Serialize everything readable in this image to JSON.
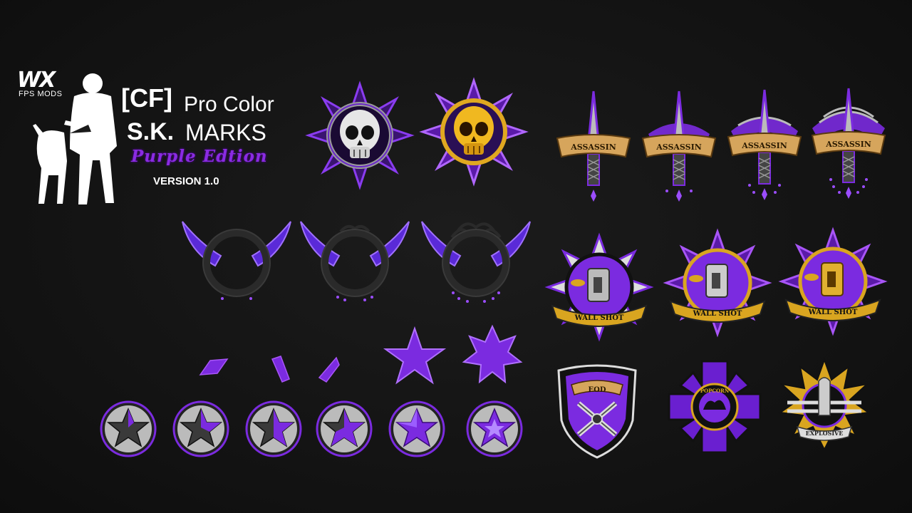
{
  "branding": {
    "logo_text": "WX",
    "logo_subtext": "FPS MODS"
  },
  "title": {
    "tag": "[CF]",
    "line1_rest": "Pro Color",
    "line2_bold": "S.K.",
    "line2_rest": "MARKS",
    "edition": "Purple Edtion",
    "version": "VERSION 1.0"
  },
  "badges": {
    "assassin_label": "ASSASSIN",
    "wallshot_label": "WALL SHOT",
    "eod_label": "EOD",
    "popcorn_label": "POPCORN",
    "explosive_label": "EXPLOSIVE"
  },
  "colors": {
    "purple": "#7b2be0",
    "purple_light": "#a855f7",
    "gold": "#d9a520",
    "silver": "#c8c8c8",
    "background": "#141414"
  }
}
